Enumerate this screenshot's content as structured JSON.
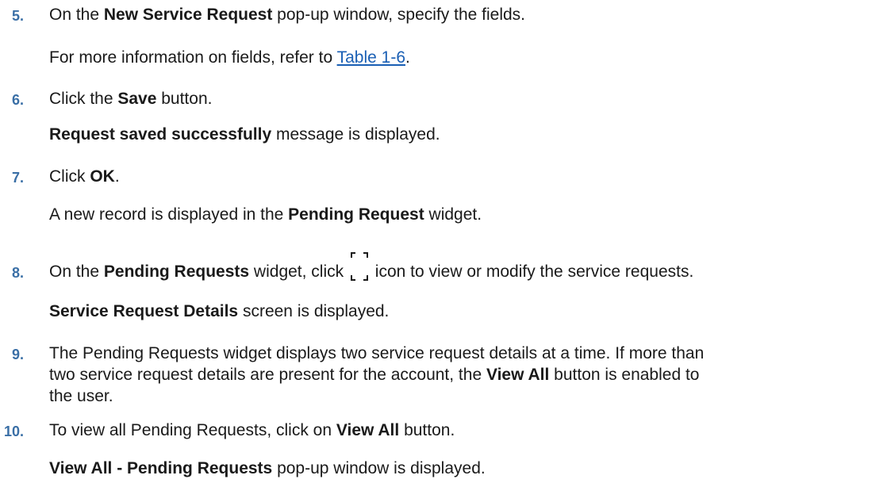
{
  "steps": [
    {
      "num": "5.",
      "pre": "On the ",
      "b1": "New Service Request",
      "post": " pop-up window, specify the fields."
    },
    {
      "sub_pre": "For more information on fields, refer to ",
      "link": "Table 1-6",
      "sub_post": "."
    },
    {
      "num": "6.",
      "pre": "Click the ",
      "b1": "Save",
      "post": " button."
    },
    {
      "sub_b": "Request saved successfully",
      "sub_post": " message is displayed."
    },
    {
      "num": "7.",
      "pre": "Click ",
      "b1": "OK",
      "post": "."
    },
    {
      "sub_pre": "A new record is displayed in the ",
      "sub_b": "Pending Request",
      "sub_post": " widget."
    },
    {
      "num": "8.",
      "pre": "On the ",
      "b1": "Pending Requests",
      "mid": " widget, click ",
      "icon": "expand-icon",
      "post": " icon to view or modify the service requests."
    },
    {
      "sub_b": "Service Request Details",
      "sub_post": " screen is displayed."
    },
    {
      "num": "9.",
      "l1": "The Pending Requests widget displays two service request details at a time. If more than",
      "l2_pre": "two service request details are present for the account, the ",
      "l2_b": "View All",
      "l2_post": " button is enabled to",
      "l3": "the user."
    },
    {
      "num": "10.",
      "pre": "To view all Pending Requests, click on ",
      "b1": "View All",
      "post": " button."
    },
    {
      "sub_b": "View All - Pending Requests",
      "sub_post": " pop-up window is displayed."
    }
  ],
  "colors": {
    "step_number": "#3a6fa6",
    "link": "#1a5fb4",
    "text": "#1a1a1a"
  }
}
